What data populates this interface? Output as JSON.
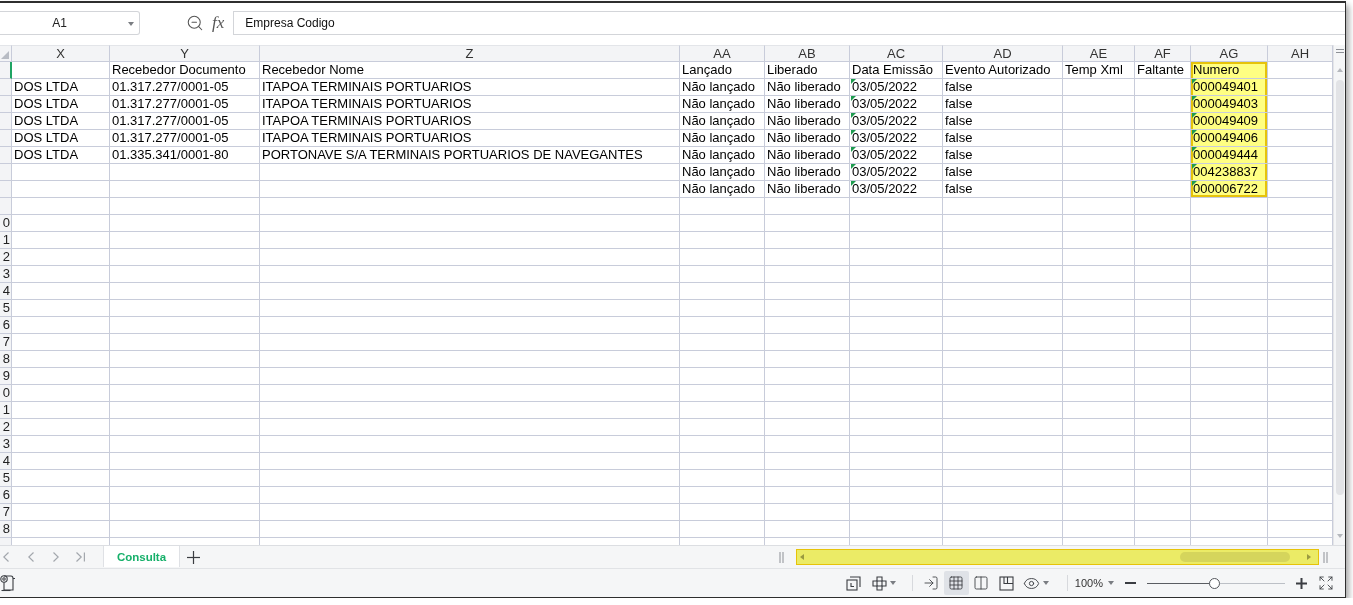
{
  "formula_bar": {
    "name_box": "A1",
    "function_label": "fx",
    "formula": "Empresa Codigo"
  },
  "columns": [
    {
      "label": "X",
      "highlighted": false
    },
    {
      "label": "Y",
      "highlighted": false
    },
    {
      "label": "Z",
      "highlighted": false
    },
    {
      "label": "AA",
      "highlighted": false
    },
    {
      "label": "AB",
      "highlighted": false
    },
    {
      "label": "AC",
      "highlighted": false
    },
    {
      "label": "AD",
      "highlighted": false
    },
    {
      "label": "AE",
      "highlighted": false
    },
    {
      "label": "AF",
      "highlighted": false
    },
    {
      "label": "AG",
      "highlighted": true
    },
    {
      "label": "AH",
      "highlighted": false
    }
  ],
  "rows": [
    {
      "selected": true,
      "cells": [
        null,
        {
          "text": "Recebedor Documento",
          "flag": false
        },
        {
          "text": "Recebedor Nome",
          "flag": false
        },
        {
          "text": "Lançado",
          "flag": false
        },
        {
          "text": "Liberado",
          "flag": false
        },
        {
          "text": "Data Emissão",
          "flag": false
        },
        {
          "text": "Evento Autorizado",
          "flag": false
        },
        {
          "text": "Temp Xml",
          "flag": false
        },
        {
          "text": "Faltante",
          "flag": false
        },
        {
          "text": "Numero",
          "flag": false
        },
        null
      ]
    },
    {
      "selected": false,
      "cells": [
        {
          "text": "DOS LTDA",
          "flag": false
        },
        {
          "text": "01.317.277/0001-05",
          "flag": false
        },
        {
          "text": "ITAPOA TERMINAIS PORTUARIOS",
          "flag": false
        },
        {
          "text": "Não lançado",
          "flag": false
        },
        {
          "text": "Não liberado",
          "flag": false
        },
        {
          "text": "03/05/2022",
          "flag": true
        },
        {
          "text": "false",
          "flag": false
        },
        null,
        null,
        {
          "text": "000049401",
          "flag": true
        },
        null
      ]
    },
    {
      "selected": false,
      "cells": [
        {
          "text": "DOS LTDA",
          "flag": false
        },
        {
          "text": "01.317.277/0001-05",
          "flag": false
        },
        {
          "text": "ITAPOA TERMINAIS PORTUARIOS",
          "flag": false
        },
        {
          "text": "Não lançado",
          "flag": false
        },
        {
          "text": "Não liberado",
          "flag": false
        },
        {
          "text": "03/05/2022",
          "flag": true
        },
        {
          "text": "false",
          "flag": false
        },
        null,
        null,
        {
          "text": "000049403",
          "flag": true
        },
        null
      ]
    },
    {
      "selected": false,
      "cells": [
        {
          "text": "DOS LTDA",
          "flag": false
        },
        {
          "text": "01.317.277/0001-05",
          "flag": false
        },
        {
          "text": "ITAPOA TERMINAIS PORTUARIOS",
          "flag": false
        },
        {
          "text": "Não lançado",
          "flag": false
        },
        {
          "text": "Não liberado",
          "flag": false
        },
        {
          "text": "03/05/2022",
          "flag": true
        },
        {
          "text": "false",
          "flag": false
        },
        null,
        null,
        {
          "text": "000049409",
          "flag": true
        },
        null
      ]
    },
    {
      "selected": false,
      "cells": [
        {
          "text": "DOS LTDA",
          "flag": false
        },
        {
          "text": "01.317.277/0001-05",
          "flag": false
        },
        {
          "text": "ITAPOA TERMINAIS PORTUARIOS",
          "flag": false
        },
        {
          "text": "Não lançado",
          "flag": false
        },
        {
          "text": "Não liberado",
          "flag": false
        },
        {
          "text": "03/05/2022",
          "flag": true
        },
        {
          "text": "false",
          "flag": false
        },
        null,
        null,
        {
          "text": "000049406",
          "flag": true
        },
        null
      ]
    },
    {
      "selected": false,
      "cells": [
        {
          "text": "DOS LTDA",
          "flag": false
        },
        {
          "text": "01.335.341/0001-80",
          "flag": false
        },
        {
          "text": "PORTONAVE S/A TERMINAIS PORTUARIOS DE NAVEGANTES",
          "flag": false
        },
        {
          "text": "Não lançado",
          "flag": false
        },
        {
          "text": "Não liberado",
          "flag": false
        },
        {
          "text": "03/05/2022",
          "flag": true
        },
        {
          "text": "false",
          "flag": false
        },
        null,
        null,
        {
          "text": "000049444",
          "flag": true
        },
        null
      ]
    },
    {
      "selected": false,
      "cells": [
        null,
        null,
        null,
        {
          "text": "Não lançado",
          "flag": false
        },
        {
          "text": "Não liberado",
          "flag": false
        },
        {
          "text": "03/05/2022",
          "flag": true
        },
        {
          "text": "false",
          "flag": false
        },
        null,
        null,
        {
          "text": "004238837",
          "flag": true
        },
        null
      ]
    },
    {
      "selected": false,
      "cells": [
        null,
        null,
        null,
        {
          "text": "Não lançado",
          "flag": false
        },
        {
          "text": "Não liberado",
          "flag": false
        },
        {
          "text": "03/05/2022",
          "flag": true
        },
        {
          "text": "false",
          "flag": false
        },
        null,
        null,
        {
          "text": "000006722",
          "flag": true
        },
        null
      ]
    },
    {
      "selected": false
    },
    {
      "number": "0",
      "selected": false
    },
    {
      "number": "1",
      "selected": false
    },
    {
      "number": "2",
      "selected": false
    },
    {
      "number": "3",
      "selected": false
    },
    {
      "number": "4",
      "selected": false
    },
    {
      "number": "5",
      "selected": false
    },
    {
      "number": "6",
      "selected": false
    },
    {
      "number": "7",
      "selected": false
    },
    {
      "number": "8",
      "selected": false
    },
    {
      "number": "9",
      "selected": false
    },
    {
      "number": "0",
      "selected": false
    },
    {
      "number": "1",
      "selected": false
    },
    {
      "number": "2",
      "selected": false
    },
    {
      "number": "3",
      "selected": false
    },
    {
      "number": "4",
      "selected": false
    },
    {
      "number": "5",
      "selected": false
    },
    {
      "number": "6",
      "selected": false
    },
    {
      "number": "7",
      "selected": false
    },
    {
      "number": "8",
      "selected": false
    },
    {
      "selected": false
    }
  ],
  "sheet_tabs": [
    {
      "label": "Consulta",
      "selected": true
    }
  ],
  "horizontal_scrollbar": {
    "highlighted": true
  },
  "status_bar": {
    "views": [
      {
        "kind": "reading",
        "selected": false
      },
      {
        "kind": "normal",
        "selected": true
      },
      {
        "kind": "page_layout",
        "selected": false
      },
      {
        "kind": "page_break",
        "selected": false
      }
    ],
    "zoom": {
      "label": "100%",
      "level": 0.49
    }
  }
}
